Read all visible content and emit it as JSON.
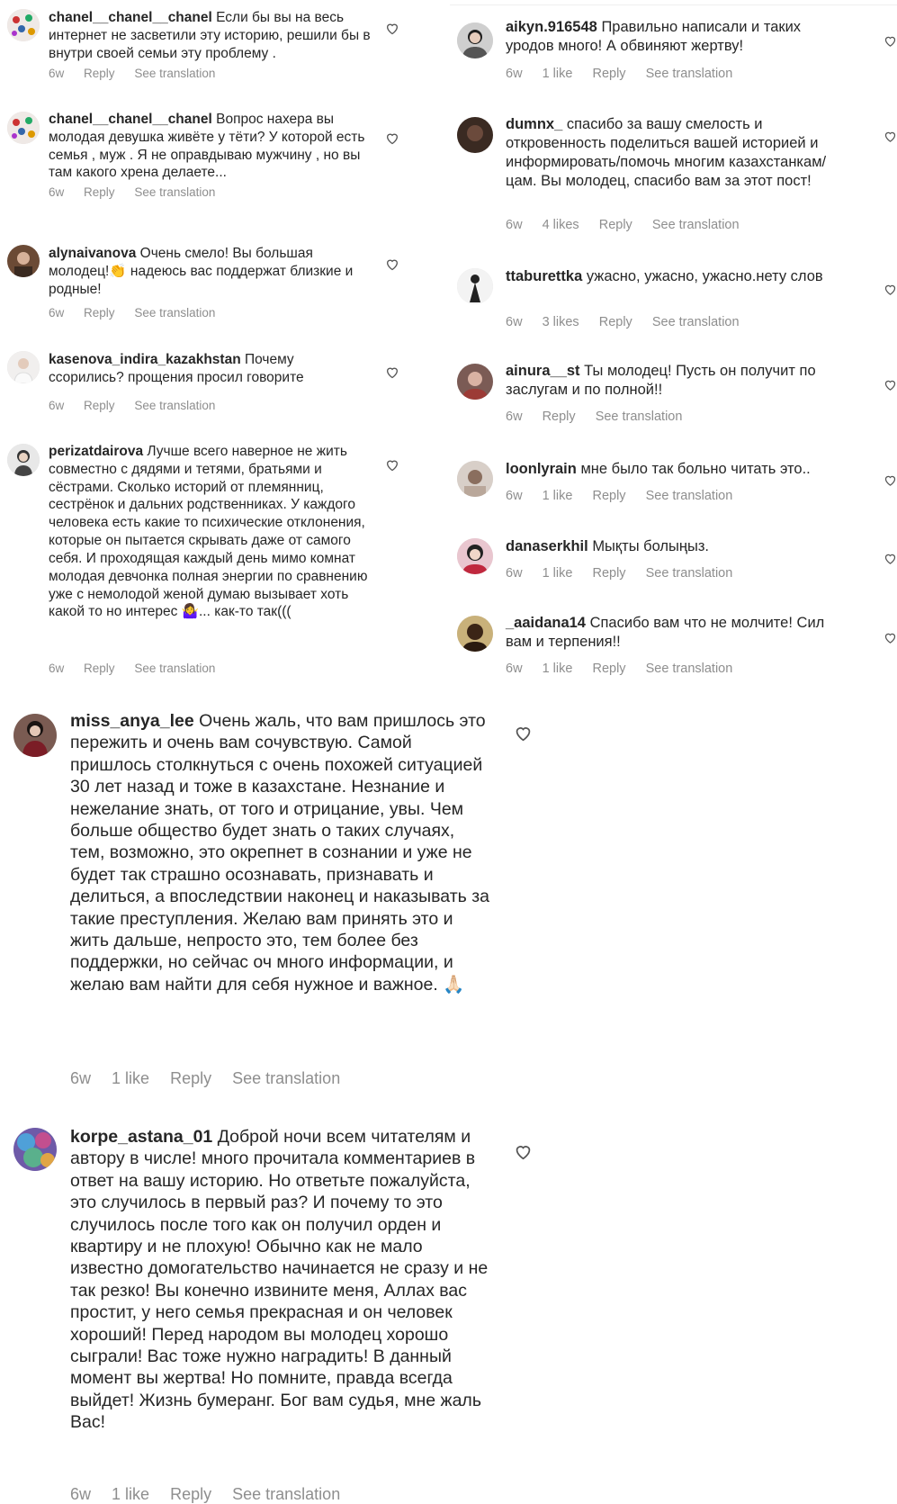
{
  "left_column": [
    {
      "username": "chanel__chanel__chanel",
      "text": "Если бы вы на весь интернет не засветили эту историю, решили бы  в внутри своей семьи эту проблему .",
      "time": "6w",
      "likes": "",
      "reply": "Reply",
      "translate": "See translation"
    },
    {
      "username": "chanel__chanel__chanel",
      "text": "Вопрос нахера вы молодая девушка живёте у тёти? У которой есть семья , муж . Я не оправдываю мужчину , но вы там какого хрена делаете...",
      "time": "6w",
      "likes": "",
      "reply": "Reply",
      "translate": "See translation"
    },
    {
      "username": "alynaivanova",
      "text": "Очень смело! Вы большая молодец!👏 надеюсь вас поддержат близкие и родные!",
      "time": "6w",
      "likes": "",
      "reply": "Reply",
      "translate": "See translation"
    },
    {
      "username": "kasenova_indira_kazakhstan",
      "text": "Почему ссорились? прощения просил говорите",
      "time": "6w",
      "likes": "",
      "reply": "Reply",
      "translate": "See translation"
    },
    {
      "username": "perizatdairova",
      "text": "Лучше всего наверное не жить совместно с дядями и тетями, братьями и сёстрами. Сколько историй от племянниц, сестрёнок и дальних родственниках. У каждого человека есть какие то психические отклонения, которые он пытается скрывать даже от самого себя. И проходящая каждый день мимо комнат молодая девчонка полная энергии по сравнению уже с немолодой женой думаю вызывает хоть какой то но интерес 🤷‍♀️... как-то так(((",
      "time": "6w",
      "likes": "",
      "reply": "Reply",
      "translate": "See translation"
    }
  ],
  "right_column": [
    {
      "username": "aikyn.916548",
      "text": "Правильно написали и таких уродов много! А обвиняют  жертву!",
      "time": "6w",
      "likes": "1 like",
      "reply": "Reply",
      "translate": "See translation"
    },
    {
      "username": "dumnx_",
      "text": "спасибо за вашу смелость и откровенность поделиться вашей историей и информировать/помочь многим казахстанкам/цам. Вы молодец, спасибо вам за этот пост!",
      "time": "6w",
      "likes": "4 likes",
      "reply": "Reply",
      "translate": "See translation"
    },
    {
      "username": "ttaburettka",
      "text": "ужасно, ужасно, ужасно.нету слов",
      "time": "6w",
      "likes": "3 likes",
      "reply": "Reply",
      "translate": "See translation"
    },
    {
      "username": "ainura__st",
      "text": "Ты молодец! Пусть он получит по заслугам и по полной!!",
      "time": "6w",
      "likes": "",
      "reply": "Reply",
      "translate": "See translation"
    },
    {
      "username": "loonlyrain",
      "text": "мне было так больно читать это..",
      "time": "6w",
      "likes": "1 like",
      "reply": "Reply",
      "translate": "See translation"
    },
    {
      "username": "danaserkhil",
      "text": "Мықты болыңыз.",
      "time": "6w",
      "likes": "1 like",
      "reply": "Reply",
      "translate": "See translation"
    },
    {
      "username": "_aaidana14",
      "text": "Спасибо вам что не молчите! Сил вам и терпения!!",
      "time": "6w",
      "likes": "1 like",
      "reply": "Reply",
      "translate": "See translation"
    }
  ],
  "large_comments": [
    {
      "username": "miss_anya_lee",
      "text": "Очень жаль, что вам пришлось это пережить и очень вам сочувствую. Самой пришлось столкнуться с очень похожей ситуацией 30 лет назад и тоже в казахстане. Незнание и нежелание знать, от того и отрицание, увы. Чем больше общество будет знать о таких случаях, тем, возможно, это окрепнет в сознании и уже не будет так страшно осознавать, признавать и делиться, а впоследствии наконец и  наказывать за такие преступления. Желаю вам принять это и жить дальше, непросто это, тем более без поддержки, но сейчас оч много информации, и желаю вам найти для себя нужное и важное. 🙏🏻",
      "time": "6w",
      "likes": "1 like",
      "reply": "Reply",
      "translate": "See translation"
    },
    {
      "username": "korpe_astana_01",
      "text": "Доброй ночи всем читателям и автору в числе!  много прочитала комментариев в ответ на вашу историю. Но ответьте пожалуйста, это случилось в первый раз?  И почему то это случилось после того как он получил орден и квартиру и не плохую! Обычно как не мало известно домогательство начинается не сразу и не так резко!  Вы конечно извините меня,  Аллах вас простит, у него семья прекрасная и он человек хороший! Перед народом вы молодец хорошо сыграли!  Вас тоже нужно наградить!  В данный момент вы жертва!  Но помните, правда всегда выйдет!  Жизнь бумеранг. Бог вам судья, мне жаль Вас!",
      "time": "6w",
      "likes": "1 like",
      "reply": "Reply",
      "translate": "See translation"
    }
  ],
  "icons": {
    "like": "heart-outline-icon"
  },
  "colors": {
    "text": "#262626",
    "meta": "#8e8e8e",
    "background": "#ffffff"
  }
}
